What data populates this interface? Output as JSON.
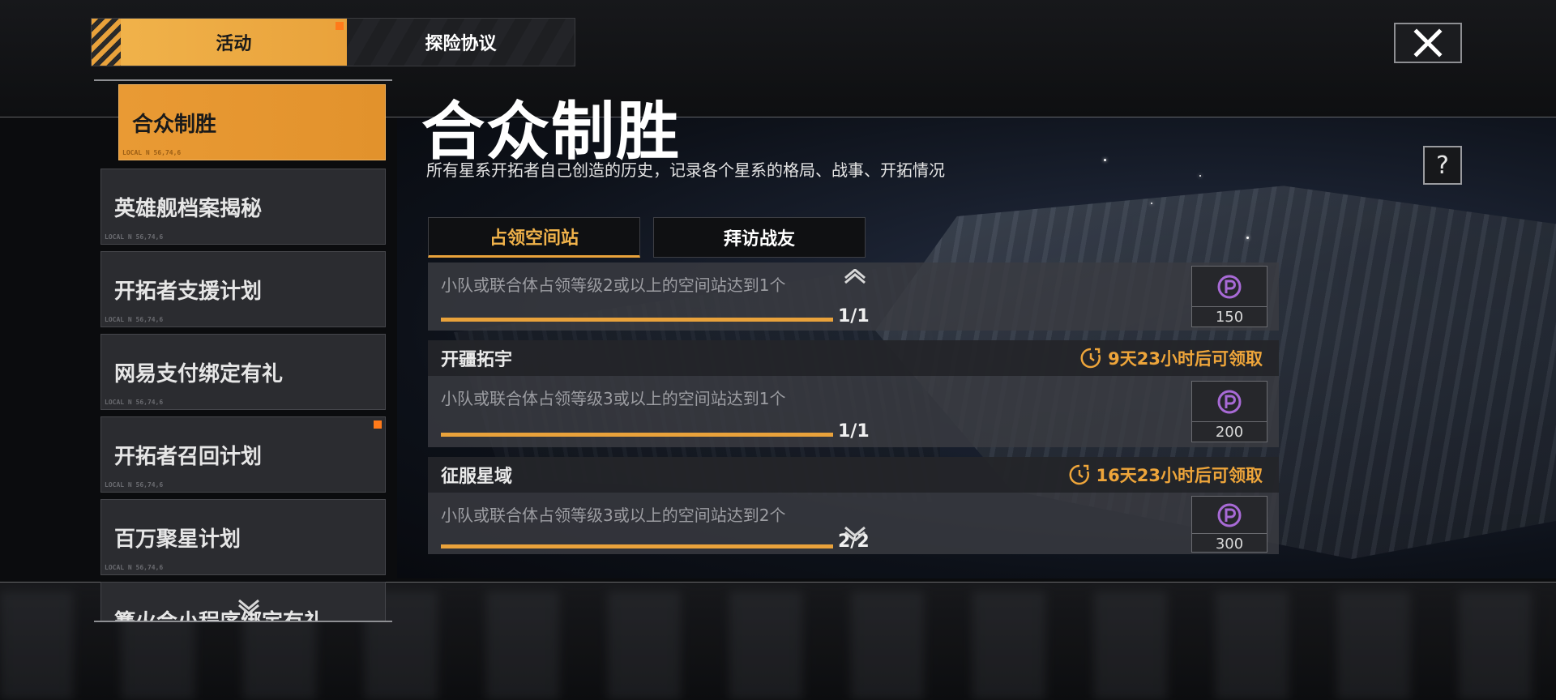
{
  "top_tabs": [
    {
      "label": "活动",
      "active": true
    },
    {
      "label": "探险协议",
      "active": false
    }
  ],
  "sidebar": {
    "items": [
      {
        "label": "合众制胜",
        "tag": "LOCAL  N 56,74,6",
        "active": true,
        "badge": false
      },
      {
        "label": "英雄舰档案揭秘",
        "tag": "LOCAL  N 56,74,6",
        "active": false,
        "badge": false
      },
      {
        "label": "开拓者支援计划",
        "tag": "LOCAL  N 56,74,6",
        "active": false,
        "badge": false
      },
      {
        "label": "网易支付绑定有礼",
        "tag": "LOCAL  N 56,74,6",
        "active": false,
        "badge": false
      },
      {
        "label": "开拓者召回计划",
        "tag": "LOCAL  N 56,74,6",
        "active": false,
        "badge": true
      },
      {
        "label": "百万聚星计划",
        "tag": "LOCAL  N 56,74,6",
        "active": false,
        "badge": false
      },
      {
        "label": "篝火会小程序绑定有礼",
        "tag": "",
        "active": false,
        "badge": false
      }
    ]
  },
  "main": {
    "title": "合众制胜",
    "subtitle": "所有星系开拓者自己创造的历史，记录各个星系的格局、战事、开拓情况",
    "help_label": "?",
    "sub_tabs": [
      {
        "label": "占领空间站",
        "active": true
      },
      {
        "label": "拜访战友",
        "active": false
      }
    ],
    "tasks": [
      {
        "name": "",
        "timer": "",
        "desc": "小队或联合体占领等级2或以上的空间站达到1个",
        "progress": "1/1",
        "progress_fraction": 1.0,
        "reward": "150"
      },
      {
        "name": "开疆拓宇",
        "timer": "9天23小时后可领取",
        "desc": "小队或联合体占领等级3或以上的空间站达到1个",
        "progress": "1/1",
        "progress_fraction": 1.0,
        "reward": "200"
      },
      {
        "name": "征服星域",
        "timer": "16天23小时后可领取",
        "desc": "小队或联合体占领等级3或以上的空间站达到2个",
        "progress": "2/2",
        "progress_fraction": 1.0,
        "reward": "300"
      }
    ]
  },
  "colors": {
    "accent": "#e9a23b",
    "reward_icon": "#a86ad6"
  },
  "icons": [
    "close-icon",
    "help-icon",
    "clock-icon",
    "coin-icon",
    "chevron-up-icon",
    "chevron-down-icon"
  ]
}
